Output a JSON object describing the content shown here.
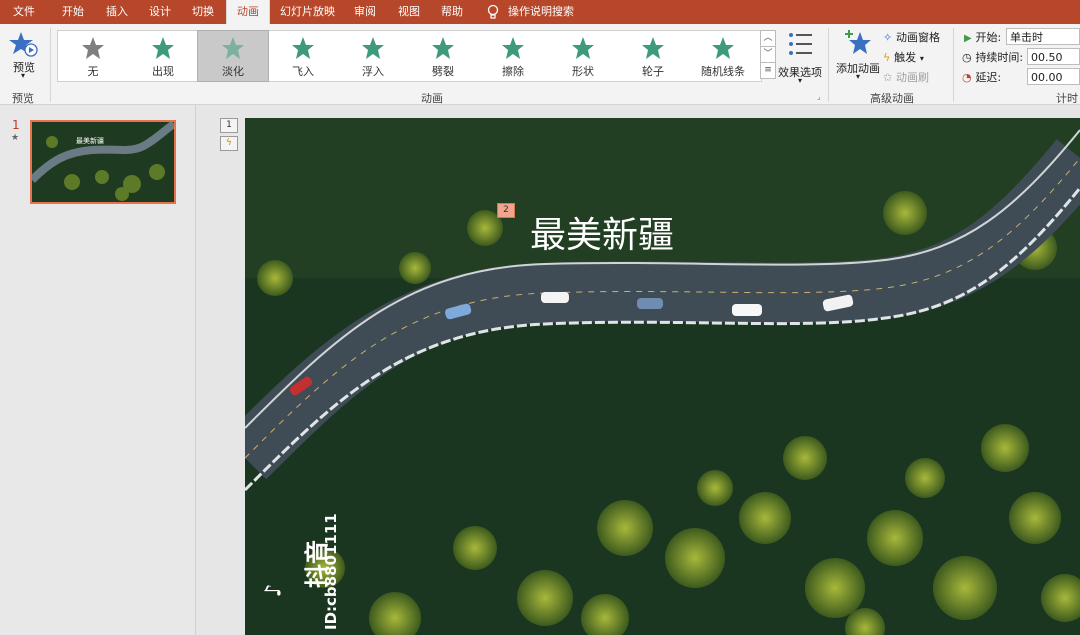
{
  "tabs": [
    "文件",
    "开始",
    "插入",
    "设计",
    "切换",
    "动画",
    "幻灯片放映",
    "审阅",
    "视图",
    "帮助",
    "操作说明搜索"
  ],
  "active_tab": "动画",
  "ribbon": {
    "preview": {
      "label": "预览",
      "group": "预览"
    },
    "gallery_items": [
      {
        "label": "无",
        "icon": "star-gray-icon"
      },
      {
        "label": "出现",
        "icon": "star-burst-icon"
      },
      {
        "label": "淡化",
        "icon": "star-fade-icon"
      },
      {
        "label": "飞入",
        "icon": "star-fly-icon"
      },
      {
        "label": "浮入",
        "icon": "star-float-icon"
      },
      {
        "label": "劈裂",
        "icon": "star-split-icon"
      },
      {
        "label": "擦除",
        "icon": "star-wipe-icon"
      },
      {
        "label": "形状",
        "icon": "star-shape-icon"
      },
      {
        "label": "轮子",
        "icon": "star-wheel-icon"
      },
      {
        "label": "随机线条",
        "icon": "star-lines-icon"
      }
    ],
    "selected_item": "淡化",
    "effect_options": "效果选项",
    "animation_group": "动画",
    "add_animation": "添加动画",
    "animation_pane": "动画窗格",
    "trigger": "触发",
    "animation_painter": "动画刷",
    "advanced_group": "高级动画",
    "timing": {
      "start_label": "开始:",
      "start_value": "单击时",
      "duration_label": "持续时间:",
      "duration_value": "00.50",
      "delay_label": "延迟:",
      "delay_value": "00.00",
      "group": "计时"
    },
    "colors": {
      "accent": "#b7472a",
      "star_green": "#3f9a7a",
      "star_gray": "#7f7f7f"
    }
  },
  "slides_panel": {
    "slide_number": "1",
    "thumb_title": "最美新疆"
  },
  "slide": {
    "title": "最美新疆",
    "title_anim_tag": "2",
    "anim_tags": [
      "1"
    ],
    "watermark_brand": "抖音",
    "watermark_id": "ID:cb8801111"
  }
}
